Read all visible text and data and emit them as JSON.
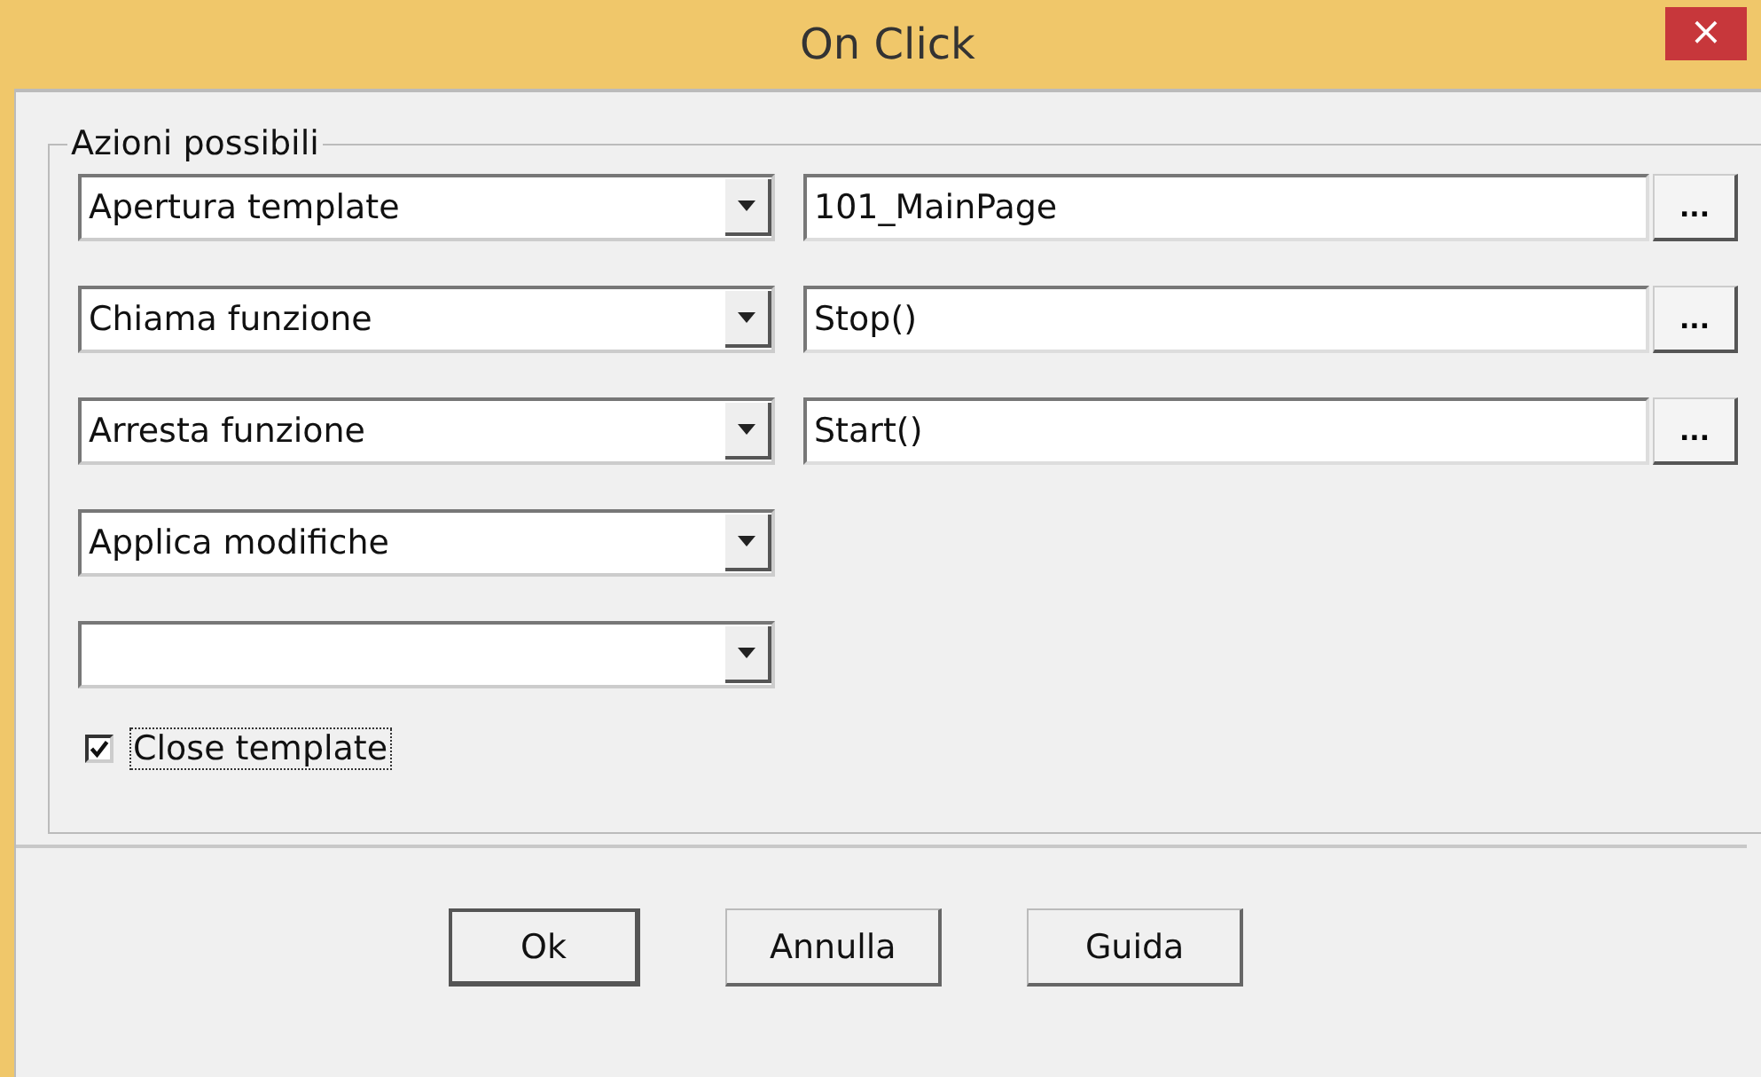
{
  "window": {
    "title": "On Click",
    "close": "×"
  },
  "group": {
    "title": "Azioni possibili"
  },
  "rows": [
    {
      "kind": "with_field",
      "action": "Apertura template",
      "value": "101_MainPage",
      "browse": "..."
    },
    {
      "kind": "with_field",
      "action": "Chiama funzione",
      "value": "Stop()",
      "browse": "..."
    },
    {
      "kind": "with_field",
      "action": "Arresta funzione",
      "value": "Start()",
      "browse": "..."
    },
    {
      "kind": "combo_only",
      "action": "Applica modifiche"
    },
    {
      "kind": "combo_only"
    }
  ],
  "checkbox": {
    "label": "Close template",
    "checked": true
  },
  "buttons": [
    {
      "label": "Ok",
      "default": true
    },
    {
      "label": "Annulla",
      "default": false
    },
    {
      "label": "Guida",
      "default": false
    }
  ]
}
